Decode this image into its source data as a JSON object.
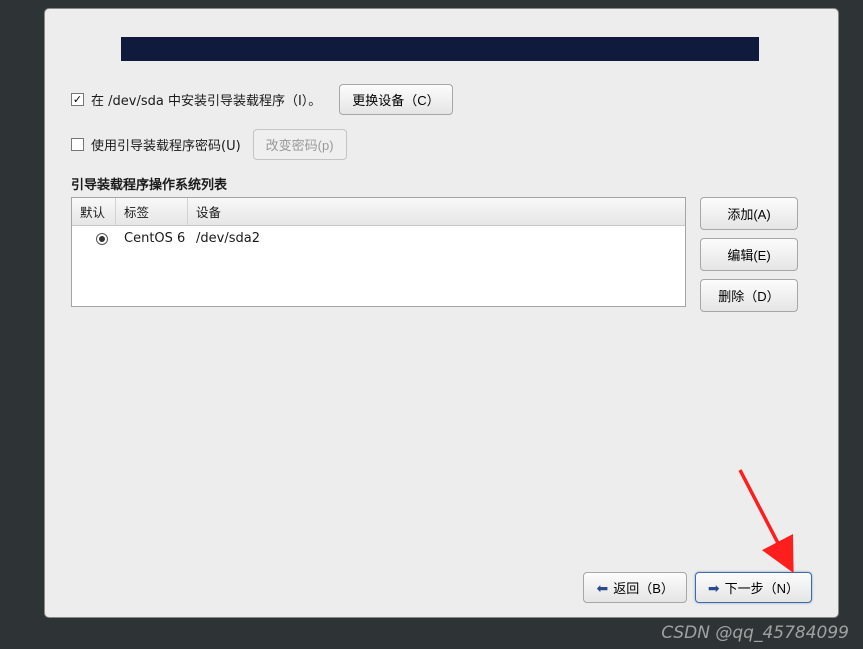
{
  "install_checkbox": {
    "checked": true,
    "label": "在 /dev/sda 中安装引导装载程序（I）。"
  },
  "change_device_button": "更换设备（C）",
  "password_row": {
    "checked": false,
    "label": "使用引导装载程序密码(U)",
    "change_password_button": "改变密码(p)"
  },
  "section_title": "引导装载程序操作系统列表",
  "table": {
    "headers": {
      "default": "默认",
      "label": "标签",
      "device": "设备"
    },
    "rows": [
      {
        "selected": true,
        "label": "CentOS 6",
        "device": "/dev/sda2"
      }
    ]
  },
  "side_buttons": {
    "add": "添加(A)",
    "edit": "编辑(E)",
    "delete": "删除（D）"
  },
  "footer": {
    "back": "返回（B）",
    "next": "下一步（N）"
  },
  "watermark": "CSDN @qq_45784099"
}
